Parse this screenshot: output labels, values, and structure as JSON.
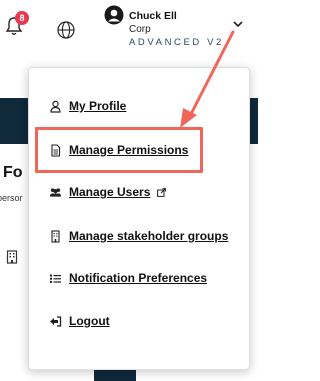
{
  "header": {
    "notification_count": "8",
    "user_name": "Chuck Ell",
    "user_org": "Corp",
    "plan_label": "ADVANCED V2"
  },
  "background": {
    "title_fragment": "Fo",
    "subtitle_fragment": "persor"
  },
  "menu": {
    "items": [
      {
        "label": "My Profile",
        "icon": "person-icon"
      },
      {
        "label": "Manage Permissions",
        "icon": "document-icon"
      },
      {
        "label": "Manage Users",
        "icon": "users-icon"
      },
      {
        "label": "Manage stakeholder groups",
        "icon": "building-icon"
      },
      {
        "label": "Notification Preferences",
        "icon": "list-icon"
      },
      {
        "label": "Logout",
        "icon": "logout-icon"
      }
    ]
  },
  "annotation": {
    "color": "#f0665b",
    "highlighted_item": "Manage Permissions"
  }
}
